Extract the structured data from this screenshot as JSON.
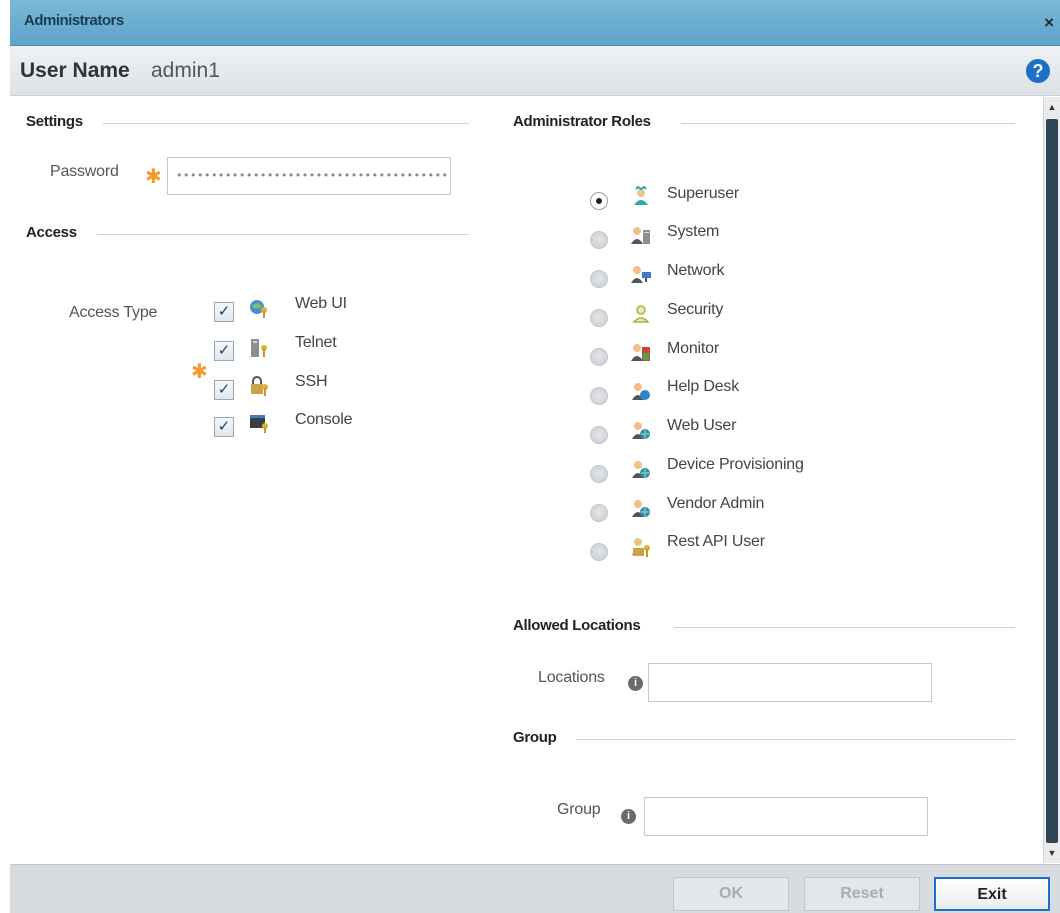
{
  "window": {
    "title": "Administrators",
    "close_label": "×"
  },
  "user": {
    "label": "User Name",
    "value": "admin1"
  },
  "help_label": "?",
  "settings": {
    "heading": "Settings",
    "password_label": "Password",
    "password_value": "••••••••••••••••••••••••••••••••••••••••••••••"
  },
  "access": {
    "heading": "Access",
    "type_label": "Access Type",
    "items": [
      {
        "label": "Web UI",
        "checked": true,
        "icon": "web-ui-icon"
      },
      {
        "label": "Telnet",
        "checked": true,
        "icon": "telnet-icon"
      },
      {
        "label": "SSH",
        "checked": true,
        "icon": "ssh-icon"
      },
      {
        "label": "Console",
        "checked": true,
        "icon": "console-icon"
      }
    ]
  },
  "roles": {
    "heading": "Administrator Roles",
    "selected": "Superuser",
    "items": [
      {
        "label": "Superuser",
        "icon": "superuser-icon"
      },
      {
        "label": "System",
        "icon": "system-icon"
      },
      {
        "label": "Network",
        "icon": "network-icon"
      },
      {
        "label": "Security",
        "icon": "security-icon"
      },
      {
        "label": "Monitor",
        "icon": "monitor-icon"
      },
      {
        "label": "Help Desk",
        "icon": "help-desk-icon"
      },
      {
        "label": "Web User",
        "icon": "web-user-icon"
      },
      {
        "label": "Device Provisioning",
        "icon": "device-provisioning-icon"
      },
      {
        "label": "Vendor Admin",
        "icon": "vendor-admin-icon"
      },
      {
        "label": "Rest API User",
        "icon": "rest-api-user-icon"
      }
    ]
  },
  "allowed_locations": {
    "heading": "Allowed Locations",
    "label": "Locations",
    "value": ""
  },
  "group": {
    "heading": "Group",
    "label": "Group",
    "value": ""
  },
  "info_glyph": "i",
  "footer": {
    "ok": "OK",
    "reset": "Reset",
    "exit": "Exit"
  },
  "colors": {
    "titlebar": "#5fa4c9",
    "accent": "#1e6fc8",
    "required": "#f39a2b"
  }
}
